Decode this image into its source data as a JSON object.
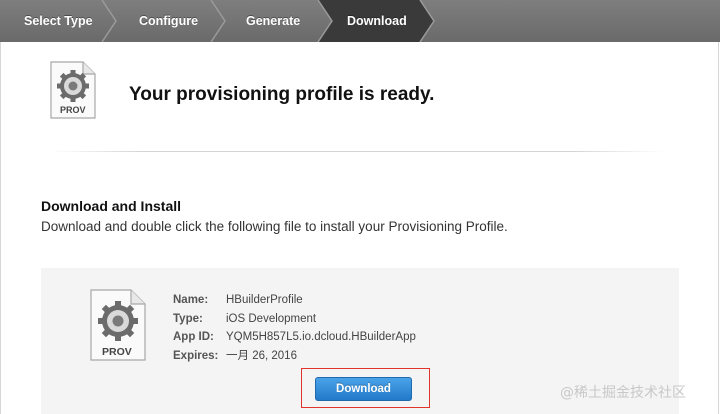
{
  "steps": [
    {
      "label": "Select Type"
    },
    {
      "label": "Configure"
    },
    {
      "label": "Generate"
    },
    {
      "label": "Download",
      "active": true
    }
  ],
  "header": {
    "icon_caption": "PROV",
    "title": "Your provisioning profile is ready."
  },
  "install": {
    "heading": "Download and Install",
    "description": "Download and double click the following file to install your Provisioning Profile."
  },
  "profile": {
    "icon_caption": "PROV",
    "fields": [
      {
        "label": "Name:",
        "value": "HBuilderProfile"
      },
      {
        "label": "Type:",
        "value": "iOS Development"
      },
      {
        "label": "App ID:",
        "value": "YQM5H857L5.io.dcloud.HBuilderApp"
      },
      {
        "label": "Expires:",
        "value": "一月 26, 2016"
      }
    ],
    "download_label": "Download"
  },
  "watermark": "@稀土掘金技术社区",
  "colors": {
    "stepbar": "#737373",
    "active_step": "#3a3a3a",
    "button": "#2a82d1",
    "highlight": "#e0342c"
  }
}
